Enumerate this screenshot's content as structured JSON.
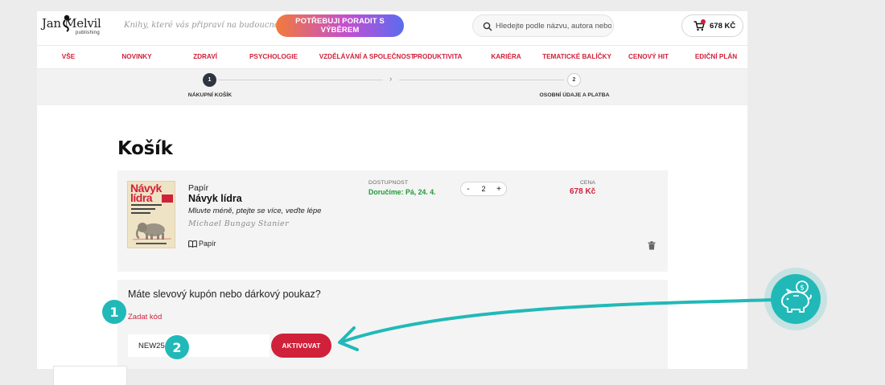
{
  "header": {
    "logo_text": "Jan Melvil",
    "logo_sub": "publishing",
    "tagline": "Knihy, které vás připraví na budoucnost",
    "advice_button": "POTŘEBUJI PORADIT S VÝBĚREM",
    "search_placeholder": "Hledejte podle názvu, autora nebo",
    "cart_total": "678 KČ"
  },
  "nav": {
    "items": [
      "VŠE",
      "NOVINKY",
      "ZDRAVÍ",
      "PSYCHOLOGIE",
      "VZDĚLÁVÁNÍ A SPOLEČNOST",
      "PRODUKTIVITA",
      "KARIÉRA",
      "TEMATICKÉ BALÍČKY",
      "CENOVÝ HIT",
      "EDIČNÍ PLÁN"
    ]
  },
  "steps": [
    {
      "number": "1",
      "label": "NÁKUPNÍ KOŠÍK"
    },
    {
      "number": "2",
      "label": "OSOBNÍ ÚDAJE A PLATBA"
    }
  ],
  "page_title": "Košík",
  "cart_item": {
    "cover_title": "Návyk lídra",
    "format": "Papír",
    "title": "Návyk lídra",
    "subtitle": "Mluvte méně, ptejte se více, veďte lépe",
    "author": "Michael Bungay Stanier",
    "type_label": "Papír",
    "availability_label": "DOSTUPNOST",
    "availability_value": "Doručíme: Pá, 24. 4.",
    "qty_minus": "-",
    "quantity": "2",
    "qty_plus": "+",
    "price_label": "CENA",
    "price": "678 Kč"
  },
  "coupon": {
    "question": "Máte slevový kupón nebo dárkový poukaz?",
    "link": "Zadat kód",
    "code_value": "NEW25",
    "activate_button": "AKTIVOVAT"
  },
  "annotations": {
    "marker1": "1",
    "marker2": "2"
  },
  "colors": {
    "brand_red": "#d0213a",
    "teal": "#21b9b8",
    "availability_green": "#1f9a3a"
  }
}
